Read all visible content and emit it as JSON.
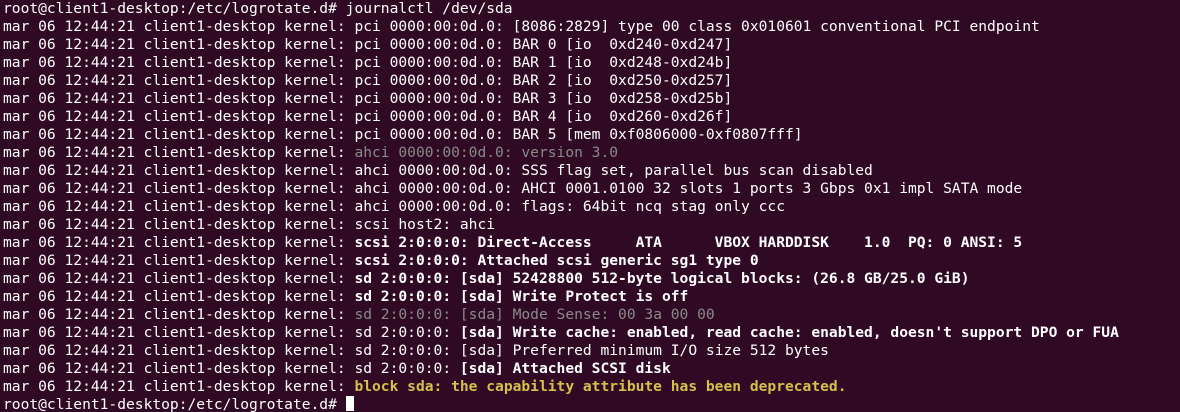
{
  "terminal": {
    "command_line": "root@client1-desktop:/etc/logrotate.d# journalctl /dev/sda",
    "prefix": "mar 06 12:44:21 client1-desktop kernel: ",
    "lines": [
      {
        "msg": "pci 0000:00:0d.0: [8086:2829] type 00 class 0x010601 conventional PCI endpoint"
      },
      {
        "msg": "pci 0000:00:0d.0: BAR 0 [io  0xd240-0xd247]"
      },
      {
        "msg": "pci 0000:00:0d.0: BAR 1 [io  0xd248-0xd24b]"
      },
      {
        "msg": "pci 0000:00:0d.0: BAR 2 [io  0xd250-0xd257]"
      },
      {
        "msg": "pci 0000:00:0d.0: BAR 3 [io  0xd258-0xd25b]"
      },
      {
        "msg": "pci 0000:00:0d.0: BAR 4 [io  0xd260-0xd26f]"
      },
      {
        "msg": "pci 0000:00:0d.0: BAR 5 [mem 0xf0806000-0xf0807fff]"
      },
      {
        "msg": "ahci 0000:00:0d.0: version 3.0"
      },
      {
        "msg": "ahci 0000:00:0d.0: SSS flag set, parallel bus scan disabled"
      },
      {
        "msg": "ahci 0000:00:0d.0: AHCI 0001.0100 32 slots 1 ports 3 Gbps 0x1 impl SATA mode"
      },
      {
        "msg": "ahci 0000:00:0d.0: flags: 64bit ncq stag only ccc"
      },
      {
        "msg": "scsi host2: ahci"
      },
      {
        "msg": "scsi 2:0:0:0: Direct-Access     ATA      VBOX HARDDISK    1.0  PQ: 0 ANSI: 5"
      },
      {
        "msg": "scsi 2:0:0:0: Attached scsi generic sg1 type 0"
      },
      {
        "msg": "sd 2:0:0:0: [sda] 52428800 512-byte logical blocks: (26.8 GB/25.0 GiB)"
      },
      {
        "msg": "sd 2:0:0:0: [sda] Write Protect is off"
      },
      {
        "src": "sd 2:0:0:0: [sda]",
        "msg": " Mode Sense: 00 3a 00 00"
      },
      {
        "src": "sd 2:0:0:0: ",
        "msg": "[sda] Write cache: enabled, read cache: enabled, doesn't support DPO or FUA"
      },
      {
        "src": "sd 2:0:0:0: ",
        "msg": "[sda] Preferred minimum I/O size 512 bytes"
      },
      {
        "src": "sd 2:0:0:0: ",
        "msg": "[sda] Attached SCSI disk"
      },
      {
        "msg": "block sda: the capability attribute has been deprecated."
      }
    ],
    "final_prompt": "root@client1-desktop:/etc/logrotate.d# "
  }
}
